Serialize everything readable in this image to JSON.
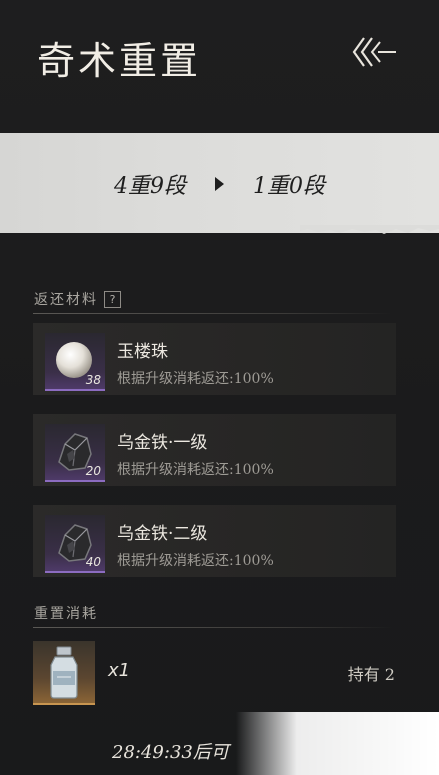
{
  "header": {
    "title": "奇术重置",
    "back_icon": "back-chevrons-icon"
  },
  "banner": {
    "from_level": "4重9段",
    "arrow_icon": "play-arrow-icon",
    "to_level": "1重0段"
  },
  "returned_materials": {
    "section_title": "返还材料",
    "help_label": "?",
    "items": [
      {
        "name": "玉楼珠",
        "count": "38",
        "desc": "根据升级消耗返还:100%",
        "icon": "pearl-orb-icon"
      },
      {
        "name": "乌金铁·一级",
        "count": "20",
        "desc": "根据升级消耗返还:100%",
        "icon": "black-iron-ore-icon"
      },
      {
        "name": "乌金铁·二级",
        "count": "40",
        "desc": "根据升级消耗返还:100%",
        "icon": "black-iron-ore-icon"
      }
    ]
  },
  "reset_cost": {
    "section_title": "重置消耗",
    "item_icon": "bottle-icon",
    "quantity": "x1",
    "held": "持有 2"
  },
  "timer": {
    "text": "28:49:33后可"
  },
  "colors": {
    "background": "#1c1c1d",
    "banner": "#dcdcda",
    "rare_purple": "#8c6cc0",
    "rare_gold": "#c89550"
  }
}
